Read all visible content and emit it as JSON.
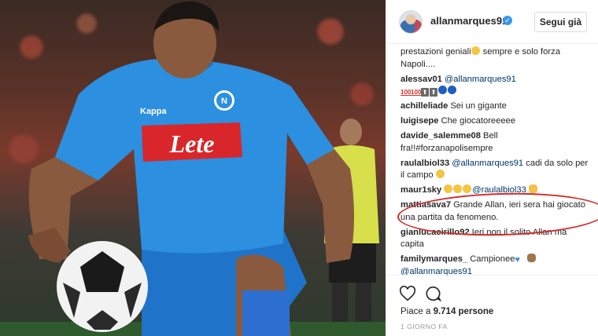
{
  "post": {
    "username": "allanmarques91",
    "follow_label": "Segui già",
    "comments": [
      {
        "user": "",
        "text": "prestazioni geniali",
        "emoji_after": [
          "smile"
        ],
        "text2": " sempre e solo forza Napoli...."
      },
      {
        "user": "alessav01",
        "mention": "@allanmarques91",
        "emoji_line": [
          "hundred",
          "hundred",
          "arrow",
          "arrow",
          "blue",
          "blue"
        ]
      },
      {
        "user": "achilleliade",
        "text": "Sei un gigante"
      },
      {
        "user": "luigisepe",
        "text": "Che giocatoreeeee"
      },
      {
        "user": "davide_salemme08",
        "text": "Bell fra!!#forzanapolisempre"
      },
      {
        "user": "raulalbiol33",
        "mention": "@allanmarques91",
        "text": " cadi da solo per il campo",
        "emoji_after": [
          "smile"
        ]
      },
      {
        "user": "maur1sky",
        "emoji_before": [
          "smile",
          "smile",
          "smile"
        ],
        "mention": "@raulalbiol33",
        "emoji_after": [
          "hands"
        ]
      },
      {
        "user": "mattiasava7",
        "text": "Grande Allan, ieri sera hai giocato una partita da fenomeno."
      },
      {
        "user": "gianlucacirillo92",
        "text": "Ieri non il solito Allan ma capita"
      },
      {
        "user": "familymarques_",
        "text": "Campionee",
        "emoji_after": [
          "heart",
          "monkey"
        ],
        "mention2": "@allanmarques91"
      }
    ],
    "likes_prefix": "Piace a ",
    "likes_count": "9.714 persone",
    "time_label": "1 GIORNO FA"
  },
  "photo": {
    "jersey_sponsor": "Lete",
    "jersey_brand": "Kappa",
    "colors": {
      "jersey": "#2c8fe0",
      "sponsor_bg": "#d9262b",
      "highlight_ring": "#cf2b2b",
      "mention": "#003569"
    }
  }
}
